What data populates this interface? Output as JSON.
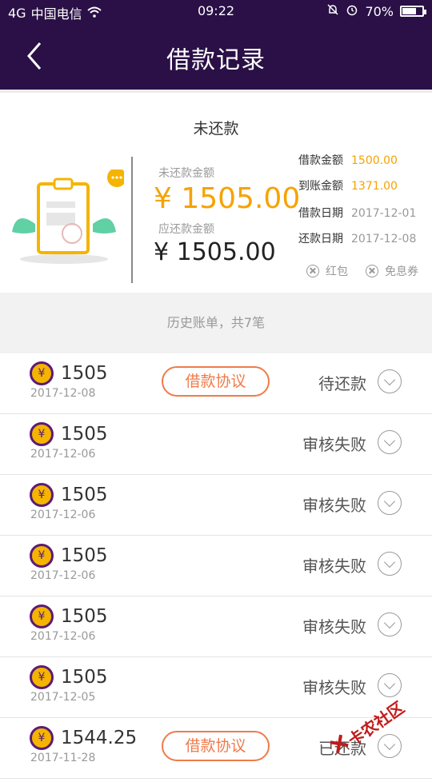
{
  "status_bar": {
    "signal": "4G",
    "carrier": "中国电信",
    "time": "09:22",
    "battery": "70%",
    "battery_level": 0.7
  },
  "header": {
    "title": "借款记录"
  },
  "summary": {
    "heading": "未还款",
    "unpaid_label": "未还款金额",
    "unpaid_amount": "¥ 1505.00",
    "due_label": "应还款金额",
    "due_amount": "¥ 1505.00",
    "details": [
      {
        "label": "借款金额",
        "value": "1500.00"
      },
      {
        "label": "到账金额",
        "value": "1371.00"
      },
      {
        "label": "借款日期",
        "value": "2017-12-01"
      },
      {
        "label": "还款日期",
        "value": "2017-12-08"
      }
    ],
    "coupons": [
      {
        "label": "红包"
      },
      {
        "label": "免息券"
      }
    ]
  },
  "history": {
    "label": "历史账单，共7笔"
  },
  "records": [
    {
      "amount": "1505",
      "date": "2017-12-08",
      "agreement": "借款协议",
      "status": "待还款"
    },
    {
      "amount": "1505",
      "date": "2017-12-06",
      "agreement": "",
      "status": "审核失败"
    },
    {
      "amount": "1505",
      "date": "2017-12-06",
      "agreement": "",
      "status": "审核失败"
    },
    {
      "amount": "1505",
      "date": "2017-12-06",
      "agreement": "",
      "status": "审核失败"
    },
    {
      "amount": "1505",
      "date": "2017-12-06",
      "agreement": "",
      "status": "审核失败"
    },
    {
      "amount": "1505",
      "date": "2017-12-05",
      "agreement": "",
      "status": "审核失败"
    },
    {
      "amount": "1544.25",
      "date": "2017-11-28",
      "agreement": "借款协议",
      "status": "已还款"
    }
  ],
  "coin_symbol": "¥",
  "watermark": "卡农社区",
  "colors": {
    "header_bg": "#2a1046",
    "accent_orange": "#f5a300",
    "agreement_border": "#f07a4a",
    "coin_fill": "#f5b400",
    "coin_border": "#5b1c74"
  }
}
